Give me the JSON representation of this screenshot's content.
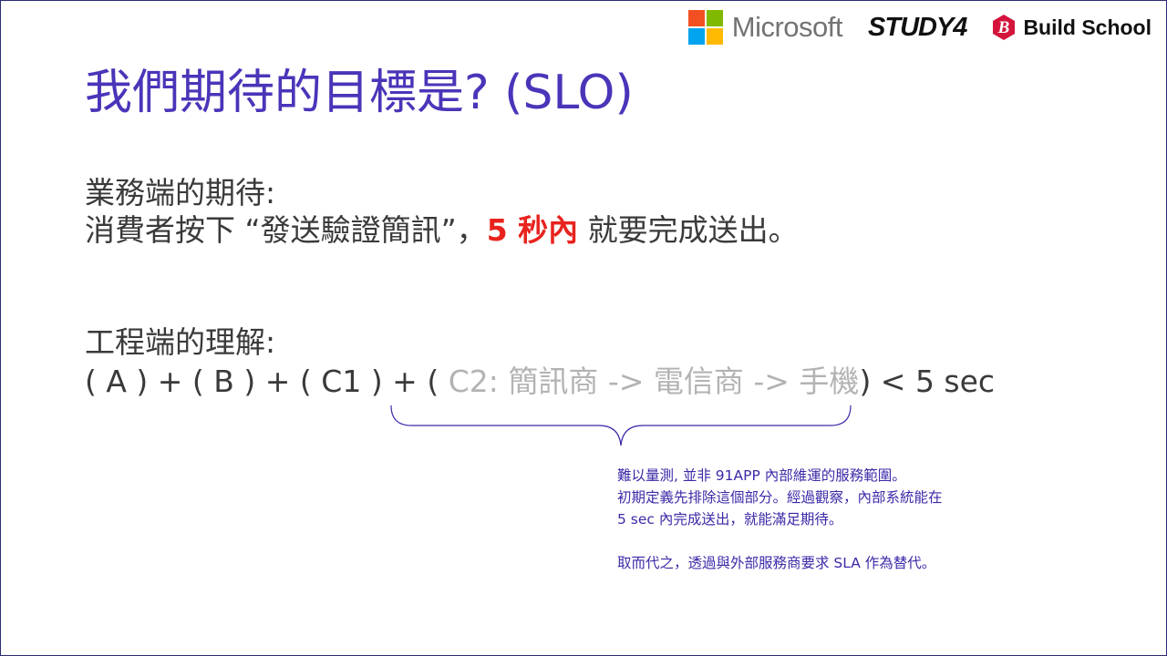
{
  "logos": {
    "microsoft": "Microsoft",
    "study4": "STUDY4",
    "build_school": "Build School",
    "build_school_letter": "B"
  },
  "title": "我們期待的目標是? (SLO)",
  "business": {
    "heading": "業務端的期待:",
    "line_pre": "消費者按下 “發送驗證簡訊”，",
    "line_highlight": "5 秒內",
    "line_post": " 就要完成送出。"
  },
  "engineering": {
    "heading": "工程端的理解:",
    "formula_pre": "( A ) + ( B ) + ( C1 ) + ( ",
    "formula_grey": "C2: 簡訊商 -> 電信商 -> 手機",
    "formula_post": ") < 5 sec"
  },
  "note": {
    "line1": "難以量測, 並非 91APP 內部維運的服務範圍。",
    "line2": "初期定義先排除這個部分。經過觀察，內部系統能在",
    "line3": "5 sec 內完成送出，就能滿足期待。",
    "line4": "取而代之，透過與外部服務商要求 SLA 作為替代。"
  },
  "colors": {
    "title": "#4a35b9",
    "highlight": "#e8231e",
    "muted": "#b3b3b3",
    "note": "#3b2aa8",
    "ms_red": "#f25022",
    "ms_green": "#7fba00",
    "ms_blue": "#00a4ef",
    "ms_yellow": "#ffb900",
    "build_school_red": "#d4143c"
  }
}
